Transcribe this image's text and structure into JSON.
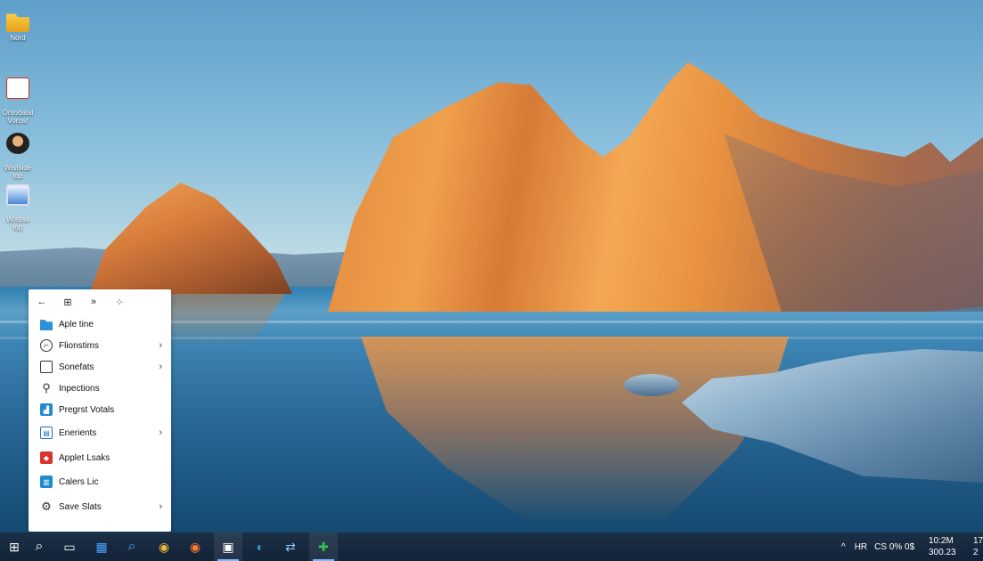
{
  "desktop": {
    "icons": [
      {
        "label": "Nord",
        "icon": "folder-icon"
      },
      {
        "label": "Orsodatai\nVorosr",
        "icon": "document-icon"
      },
      {
        "label": "Wistside\nlop",
        "icon": "avatar-icon"
      },
      {
        "label": "Wistisa\nlop",
        "icon": "monitor-icon"
      }
    ]
  },
  "start_menu": {
    "toolbar": {
      "back": "←",
      "pin": "⊞",
      "forward": "»",
      "grid": "⁘"
    },
    "items": [
      {
        "label": "Aple tine",
        "icon": "folder-icon",
        "chevron": ""
      },
      {
        "label": "Flionstims",
        "icon": "clock-icon",
        "chevron": "›"
      },
      {
        "label": "Sonefats",
        "icon": "screen-icon",
        "chevron": "›"
      },
      {
        "label": "Inpections",
        "icon": "search-icon",
        "chevron": ""
      },
      {
        "label": "Pregrst Votals",
        "icon": "chart-icon",
        "chevron": ""
      },
      {
        "label": "Enerients",
        "icon": "window-icon",
        "chevron": "›"
      },
      {
        "label": "Applet Lsaks",
        "icon": "app-icon",
        "chevron": ""
      },
      {
        "label": "Calers Lic",
        "icon": "calendar-icon",
        "chevron": ""
      },
      {
        "label": "Save Slats",
        "icon": "settings-icon",
        "chevron": "›"
      }
    ]
  },
  "taskbar": {
    "buttons": [
      {
        "name": "start",
        "glyph": "⊞"
      },
      {
        "name": "search",
        "glyph": "⌕"
      },
      {
        "name": "task-view",
        "glyph": "▭"
      },
      {
        "name": "file-explorer",
        "glyph": "▦"
      },
      {
        "name": "search-2",
        "glyph": "⌕"
      },
      {
        "name": "chrome",
        "glyph": "◉"
      },
      {
        "name": "firefox",
        "glyph": "◉"
      },
      {
        "name": "store",
        "glyph": "▣"
      },
      {
        "name": "edge",
        "glyph": "◐"
      },
      {
        "name": "network",
        "glyph": "⇄"
      },
      {
        "name": "app-green",
        "glyph": "✚"
      }
    ],
    "tray": {
      "chevron": "^",
      "lang": "HR",
      "status": "CS 0% 0$"
    },
    "clock": {
      "line1": "10:2M",
      "line2": "300.23",
      "extra1": "17",
      "extra2": "2"
    }
  },
  "colors": {
    "taskbar": "#132338",
    "accent": "#7fb6ff",
    "menu_bg": "#ffffff"
  }
}
